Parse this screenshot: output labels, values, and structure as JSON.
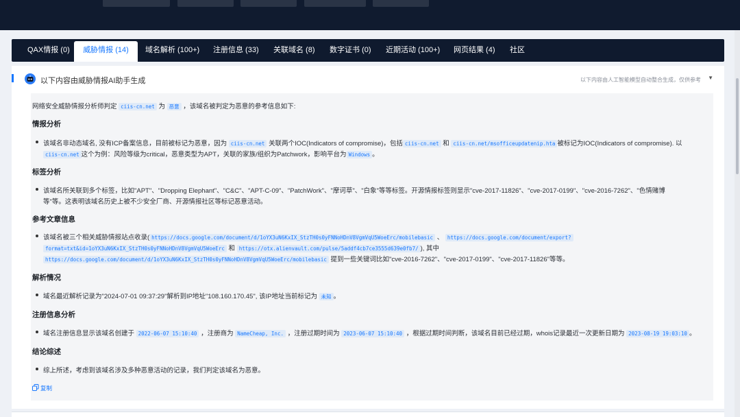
{
  "tabs": [
    {
      "label": "QAX情报 (0)"
    },
    {
      "label": "威胁情报 (14)"
    },
    {
      "label": "域名解析 (100+)"
    },
    {
      "label": "注册信息 (33)"
    },
    {
      "label": "关联域名 (8)"
    },
    {
      "label": "数字证书 (0)"
    },
    {
      "label": "近期活动 (100+)"
    },
    {
      "label": "网页结果 (4)"
    },
    {
      "label": "社区"
    }
  ],
  "panel": {
    "title": "以下内容由威胁情报AI助手生成",
    "note": "以下内容由人工智能模型自动整合生成，仅供参考",
    "copy_label": "复制"
  },
  "content": {
    "intro_a": "网络安全威胁情报分析师判定",
    "intro_domain": "ciis-cn.net",
    "intro_b": "为",
    "intro_verdict": "恶意",
    "intro_c": "，该域名被判定为恶意的参考信息如下:",
    "s1_title": "情报分析",
    "s1_a": "该域名非动态域名, 没有ICP备案信息，目前被标记为恶意，因为",
    "s1_code1": "ciis-cn.net",
    "s1_b": "关联两个IOC(Indicators of compromise)，包括",
    "s1_code2": "ciis-cn.net",
    "s1_c": "和",
    "s1_code3": "ciis-cn.net/msofficeupdatenip.hta",
    "s1_d": "被标记为IOC(Indicators of compromise). 以",
    "s1_code4": "ciis-cn.net",
    "s1_e": "这个为例：风险等级为critical，恶意类型为APT，关联的家族/组织为Patchwork，影响平台为",
    "s1_code5": "Windows",
    "s1_f": "。",
    "s2_title": "标签分析",
    "s2_line1": "该域名所关联到多个标签，比如\"APT\"、\"Dropping Elephant\"、\"C&C\"、\"APT-C-09\"、\"PatchWork\"、\"摩诃草\"、\"白象\"等等标签。开源情报标签则显示\"cve-2017-11826\"、\"cve-2017-0199\"、\"cve-2016-7262\"、\"色情赌博",
    "s2_line2": "等\"等。这表明该域名历史上被不少安全厂商、开源情报社区等标记恶意活动。",
    "s3_title": "参考文章信息",
    "s3_a": "该域名被三个相关威胁情报站点收录(",
    "s3_code1": "https://docs.google.com/document/d/1oYX3uN6KxIX_StzTH0s0yFNNoHDnV8VgmVqU5WoeErc/mobilebasic",
    "s3_b": "、",
    "s3_code2a": "https://docs.google.com/document/export?",
    "s3_code2b": "format=txt&id=1oYX3uN6KxIX_StzTH0s0yFNNoHDnV8VgmVqU5WoeErc",
    "s3_c": "和",
    "s3_code3": "https://otx.alienvault.com/pulse/5addf4cb7ce3555d639e0fb7/",
    "s3_d": "), 其中",
    "s3_code4": "https://docs.google.com/document/d/1oYX3uN6KxIX_StzTH0s0yFNNoHDnV8VgmVqU5WoeErc/mobilebasic",
    "s3_e": "提到一些关键词比如\"cve-2016-7262\"、\"cve-2017-0199\"、\"cve-2017-11826\"等等。",
    "s4_title": "解析情况",
    "s4_a": "域名最近解析记录为\"2024-07-01 09:37:29\"解析到IP地址\"108.160.170.45\", 该IP地址当前标记为",
    "s4_code": "未知",
    "s4_b": "。",
    "s5_title": "注册信息分析",
    "s5_a": "域名注册信息显示该域名创建于",
    "s5_code1": "2022-06-07 15:10:40",
    "s5_b": "，注册商为",
    "s5_code2": "NameCheap, Inc.",
    "s5_c": "，注册过期时间为",
    "s5_code3": "2023-06-07 15:10:40",
    "s5_d": "，根据过期时间判断，该域名目前已经过期，whois记录最近一次更新日期为",
    "s5_code4": "2023-08-19 19:03:10",
    "s5_e": "。",
    "s6_title": "结论综述",
    "s6_a": "综上所述，考虑到该域名涉及多种恶意活动的记录，我们判定该域名为恶意。"
  }
}
